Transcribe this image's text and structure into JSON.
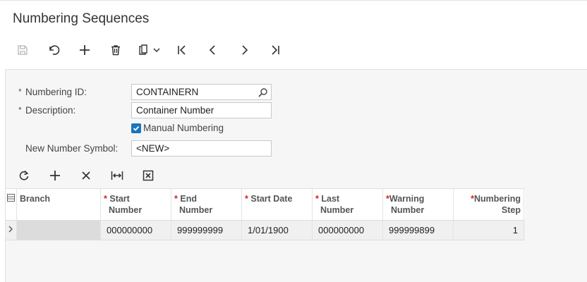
{
  "page": {
    "title": "Numbering Sequences"
  },
  "form": {
    "numbering_id_label": "Numbering ID:",
    "numbering_id_value": "CONTAINERN",
    "description_label": "Description:",
    "description_value": "Container Number",
    "manual_numbering_label": "Manual Numbering",
    "manual_numbering_checked": true,
    "new_symbol_label": "New Number Symbol:",
    "new_symbol_value": "<NEW>",
    "required_mark": "*"
  },
  "grid": {
    "columns": [
      {
        "line1": "Branch",
        "line2": "",
        "required": false
      },
      {
        "line1": "Start",
        "line2": "Number",
        "required": true
      },
      {
        "line1": "End",
        "line2": "Number",
        "required": true
      },
      {
        "line1": "Start Date",
        "line2": "",
        "required": true
      },
      {
        "line1": "Last",
        "line2": "Number",
        "required": true
      },
      {
        "line1": "Warning",
        "line2": "Number",
        "required": true
      },
      {
        "line1": "Numbering",
        "line2": "Step",
        "required": true
      }
    ],
    "rows": [
      {
        "branch": "",
        "start_number": "000000000",
        "end_number": "999999999",
        "start_date": "1/01/1900",
        "last_number": "000000000",
        "warning_number": "999999899",
        "numbering_step": "1"
      }
    ]
  },
  "colors": {
    "accent": "#1b75bb",
    "required": "#d62020"
  }
}
